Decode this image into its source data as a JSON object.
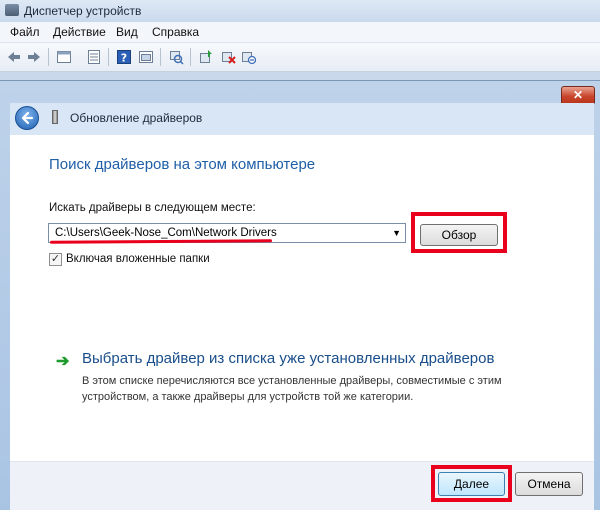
{
  "window": {
    "title": "Диспетчер устройств"
  },
  "menu": [
    "Файл",
    "Действие",
    "Вид",
    "Справка"
  ],
  "toolbar": {
    "icons": [
      "back-icon",
      "forward-icon",
      "properties-icon",
      "list-icon",
      "help-icon",
      "show-icon",
      "scan-hardware-icon",
      "update-driver-icon",
      "uninstall-icon",
      "disable-icon"
    ]
  },
  "dialog": {
    "close_label": "✕",
    "header_title": "Обновление драйверов",
    "heading": "Поиск драйверов на этом компьютере",
    "path_label": "Искать драйверы в следующем месте:",
    "path_value": "C:\\Users\\Geek-Nose_Com\\Network Drivers",
    "browse_label": "Обзор",
    "subfolders_label": "Включая вложенные папки",
    "subfolders_checked": true,
    "pick_link": "Выбрать драйвер из списка уже установленных драйверов",
    "pick_desc": "В этом списке перечисляются все установленные драйверы, совместимые с этим устройством, а также драйверы для устройств той же категории.",
    "next_label": "Далее",
    "cancel_label": "Отмена"
  },
  "colors": {
    "highlight": "#e8001c",
    "heading": "#1f5fa8",
    "link": "#1a4e8a",
    "arrow": "#1f9a2d"
  }
}
